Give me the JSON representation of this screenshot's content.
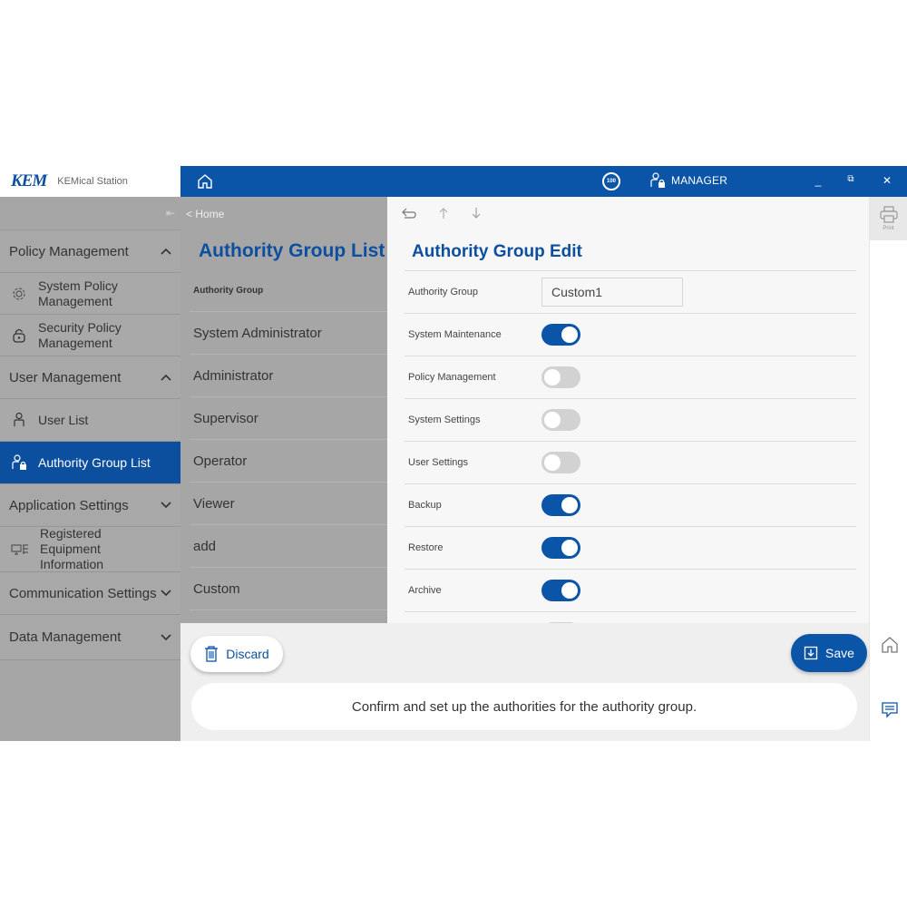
{
  "brand": {
    "logo": "KEM",
    "app_name": "KEMical Station"
  },
  "topbar": {
    "badge": "100",
    "user": "MANAGER",
    "min": "_",
    "restore": "⧉",
    "close": "✕"
  },
  "sidebar": {
    "collapse": "⇤",
    "sections": [
      {
        "label": "Policy Management",
        "chevron": "^"
      },
      {
        "label": "User Management",
        "chevron": "^"
      },
      {
        "label": "Application Settings",
        "chevron": "⌄"
      },
      {
        "label": "Communication Settings",
        "chevron": "⌄"
      },
      {
        "label": "Data Management",
        "chevron": "⌄"
      }
    ],
    "items": {
      "system_policy": "System Policy Management",
      "security_policy": "Security Policy Management",
      "user_list": "User List",
      "authority_group_list": "Authority Group List",
      "registered_equipment": "Registered Equipment Information"
    }
  },
  "list": {
    "breadcrumb": "< Home",
    "title": "Authority Group List",
    "header": "Authority Group",
    "rows": [
      "System Administrator",
      "Administrator",
      "Supervisor",
      "Operator",
      "Viewer",
      "add",
      "Custom"
    ]
  },
  "edit": {
    "title": "Authority Group Edit",
    "group_label": "Authority Group",
    "group_value": "Custom1",
    "toggles": [
      {
        "label": "System Maintenance",
        "on": true
      },
      {
        "label": "Policy Management",
        "on": false
      },
      {
        "label": "System Settings",
        "on": false
      },
      {
        "label": "User Settings",
        "on": false
      },
      {
        "label": "Backup",
        "on": true
      },
      {
        "label": "Restore",
        "on": true
      },
      {
        "label": "Archive",
        "on": true
      }
    ]
  },
  "rail": {
    "print_label": "Print"
  },
  "bottom": {
    "discard_label": "Discard",
    "save_label": "Save",
    "message": "Confirm and set up the authorities for the authority group."
  },
  "colors": {
    "primary": "#0b55a8",
    "sidebar_bg": "#a6a6a6",
    "active_item": "#0b4f9e"
  }
}
